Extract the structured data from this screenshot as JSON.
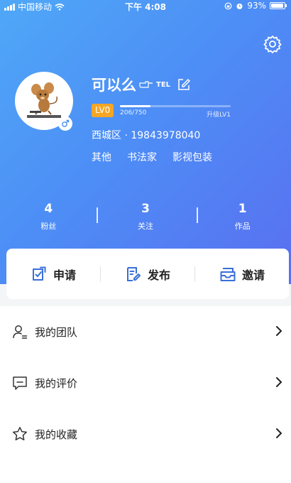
{
  "status_bar": {
    "carrier": "中国移动",
    "time": "下午 4:08",
    "battery": "93%"
  },
  "profile": {
    "name": "可以么",
    "name_badge": "TEL",
    "level": "LV0",
    "exp": "206/750",
    "exp_progress": 0.275,
    "upgrade_hint": "升级LV1",
    "location": "西城区 · 19843978040",
    "tags": [
      "其他",
      "书法家",
      "影视包装"
    ]
  },
  "stats": [
    {
      "value": "4",
      "label": "粉丝"
    },
    {
      "value": "3",
      "label": "关注"
    },
    {
      "value": "1",
      "label": "作品"
    }
  ],
  "actions": [
    {
      "label": "申请",
      "icon": "apply-icon"
    },
    {
      "label": "发布",
      "icon": "publish-icon"
    },
    {
      "label": "邀请",
      "icon": "invite-icon"
    }
  ],
  "menu": [
    {
      "label": "我的团队",
      "icon": "team-icon"
    },
    {
      "label": "我的评价",
      "icon": "comment-icon"
    },
    {
      "label": "我的收藏",
      "icon": "star-icon"
    }
  ],
  "colors": {
    "accent": "#4d8ef6",
    "level_badge": "#f5a623",
    "icon_blue": "#3a6fd8"
  }
}
